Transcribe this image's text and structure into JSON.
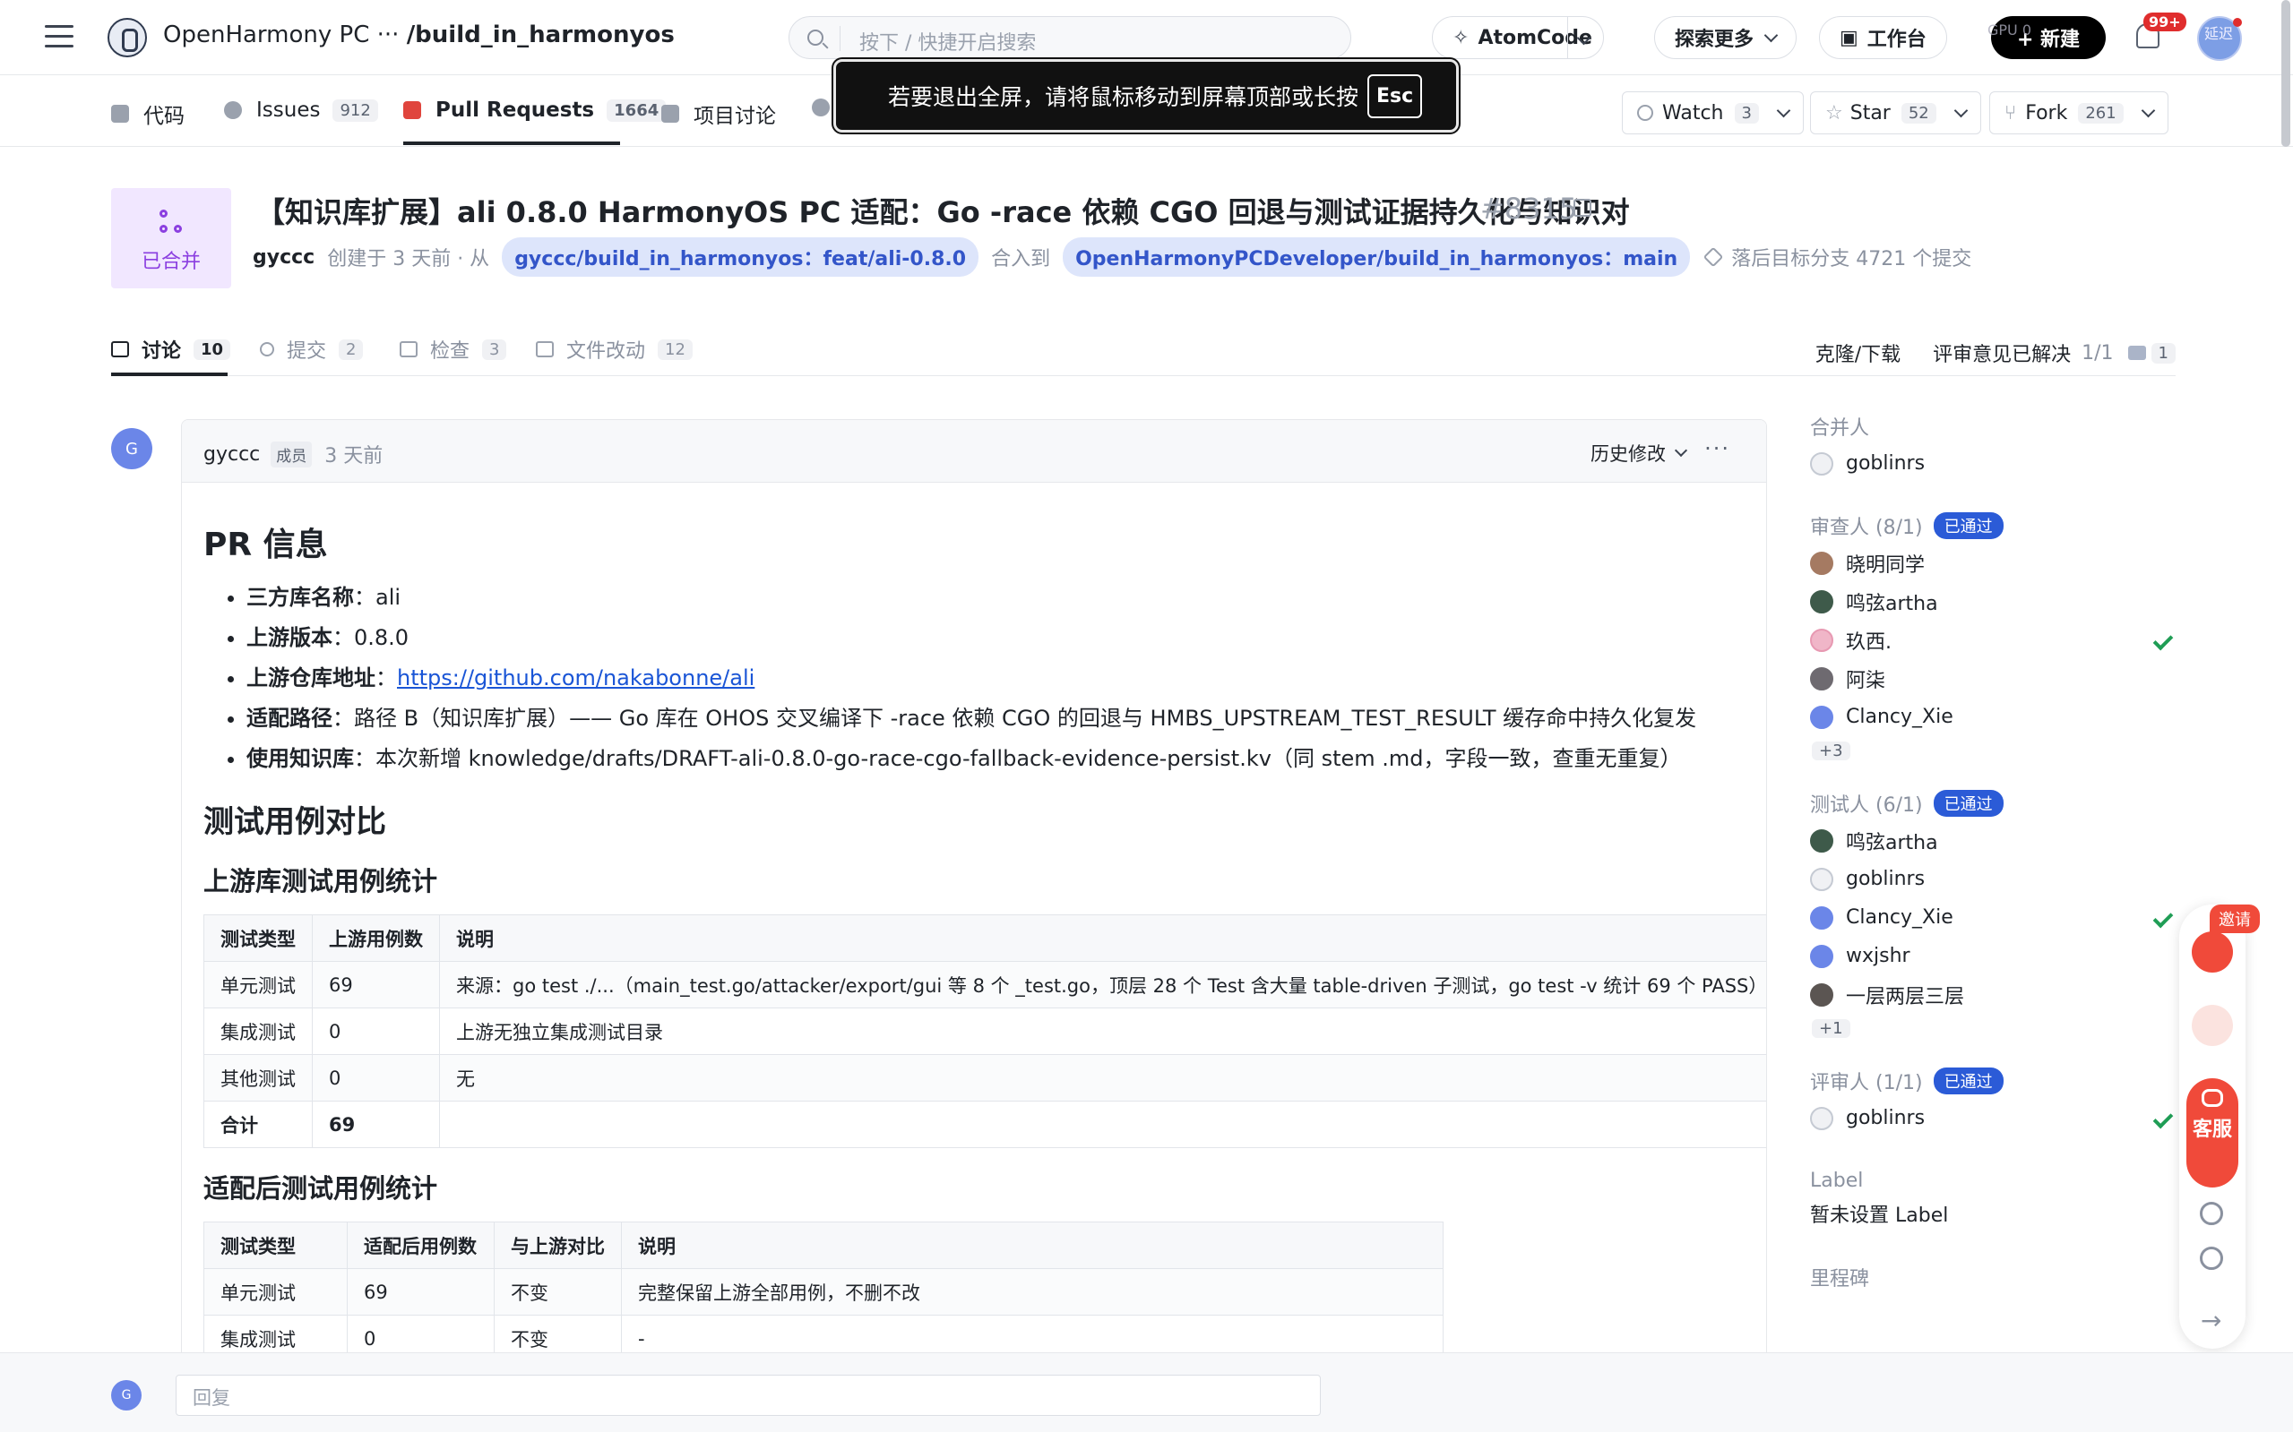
{
  "header": {
    "repo_owner": "OpenHarmony PC ···",
    "repo_name": "/build_in_harmonyos",
    "search_placeholder": "按下 / 快捷开启搜索",
    "atomcode": "AtomCode",
    "explore": "探索更多",
    "workbench": "工作台",
    "new_btn": "+ 新建",
    "notif_badge": "99+",
    "sys_overlay": "GPU 0",
    "sys_overlay2": "延迟"
  },
  "toast": {
    "text": "若要退出全屏，请将鼠标移动到屏幕顶部或长按",
    "key": "Esc"
  },
  "repo_tabs": [
    {
      "label": "代码",
      "count": ""
    },
    {
      "label": "Issues",
      "count": "912"
    },
    {
      "label": "Pull Requests",
      "count": "1664"
    },
    {
      "label": "项目讨论",
      "count": ""
    }
  ],
  "repo_actions": {
    "watch": {
      "label": "Watch",
      "count": "3"
    },
    "star": {
      "label": "Star",
      "count": "52"
    },
    "fork": {
      "label": "Fork",
      "count": "261"
    }
  },
  "pr": {
    "status": "已合并",
    "title": "【知识库扩展】ali 0.8.0 HarmonyOS PC 适配：Go -race 依赖 CGO 回退与测试证据持久化与知识对",
    "number": "#8315",
    "author": "gyccc",
    "created": "创建于 3 天前 · 从",
    "source_branch": "gyccc/build_in_harmonyos：feat/ali-0.8.0",
    "merge_into": "合入到",
    "target_branch": "OpenHarmonyPCDeveloper/build_in_harmonyos：main",
    "behind": "落后目标分支 4721 个提交"
  },
  "pr_tabs": [
    {
      "label": "讨论",
      "count": "10"
    },
    {
      "label": "提交",
      "count": "2"
    },
    {
      "label": "检查",
      "count": "3"
    },
    {
      "label": "文件改动",
      "count": "12"
    }
  ],
  "pr_tabs_right": {
    "clone": "克隆/下载",
    "resolved": "评审意见已解决",
    "resolved_count": "1/1",
    "comments": "1"
  },
  "comment": {
    "avatar": "G",
    "author": "gyccc",
    "role": "成员",
    "time": "3 天前",
    "history": "历史修改",
    "more": "···",
    "h_info": "PR 信息",
    "info": [
      {
        "k": "三方库名称",
        "v": "：ali"
      },
      {
        "k": "上游版本",
        "v": "：0.8.0"
      },
      {
        "k": "上游仓库地址",
        "v": "：",
        "link": "https://github.com/nakabonne/ali"
      },
      {
        "k": "适配路径",
        "v": "：路径 B（知识库扩展）—— Go 库在 OHOS 交叉编译下 -race 依赖 CGO 的回退与 HMBS_UPSTREAM_TEST_RESULT 缓存命中持久化复发"
      },
      {
        "k": "使用知识库",
        "v": "：本次新增 knowledge/drafts/DRAFT-ali-0.8.0-go-race-cgo-fallback-evidence-persist.kv（同 stem .md，字段一致，查重无重复）"
      }
    ],
    "h_compare": "测试用例对比",
    "h_upstream": "上游库测试用例统计",
    "upstream_table": {
      "headers": [
        "测试类型",
        "上游用例数",
        "说明"
      ],
      "rows": [
        [
          "单元测试",
          "69",
          "来源：go test ./...（main_test.go/attacker/export/gui 等 8 个 _test.go，顶层 28 个 Test 含大量 table-driven 子测试，go test -v 统计 69 个 PASS）"
        ],
        [
          "集成测试",
          "0",
          "上游无独立集成测试目录"
        ],
        [
          "其他测试",
          "0",
          "无"
        ],
        [
          "合计",
          "69",
          ""
        ]
      ]
    },
    "h_adapted": "适配后测试用例统计",
    "adapted_table": {
      "headers": [
        "测试类型",
        "适配后用例数",
        "与上游对比",
        "说明"
      ],
      "rows": [
        [
          "单元测试",
          "69",
          "不变",
          "完整保留上游全部用例，不删不改"
        ],
        [
          "集成测试",
          "0",
          "不变",
          "-"
        ]
      ]
    }
  },
  "sidebar": {
    "merger_title": "合并人",
    "mergers": [
      "goblinrs"
    ],
    "reviewers_title": "审查人 (8/1)",
    "reviewers_status": "已通过",
    "reviewers": [
      "晓明同学",
      "鸣弦artha",
      "玖西.",
      "阿柒",
      "Clancy_Xie"
    ],
    "reviewers_more": "+3",
    "testers_title": "测试人 (6/1)",
    "testers_status": "已通过",
    "testers": [
      "鸣弦artha",
      "goblinrs",
      "Clancy_Xie",
      "wxjshr",
      "一层两层三层"
    ],
    "testers_more": "+1",
    "assessors_title": "评审人 (1/1)",
    "assessors_status": "已通过",
    "assessors": [
      "goblinrs"
    ],
    "label_title": "Label",
    "label_value": "暂未设置 Label",
    "milestone_title": "里程碑"
  },
  "float": {
    "invite": "邀请",
    "service": "客服"
  },
  "reply": {
    "avatar": "G",
    "placeholder": "回复"
  }
}
